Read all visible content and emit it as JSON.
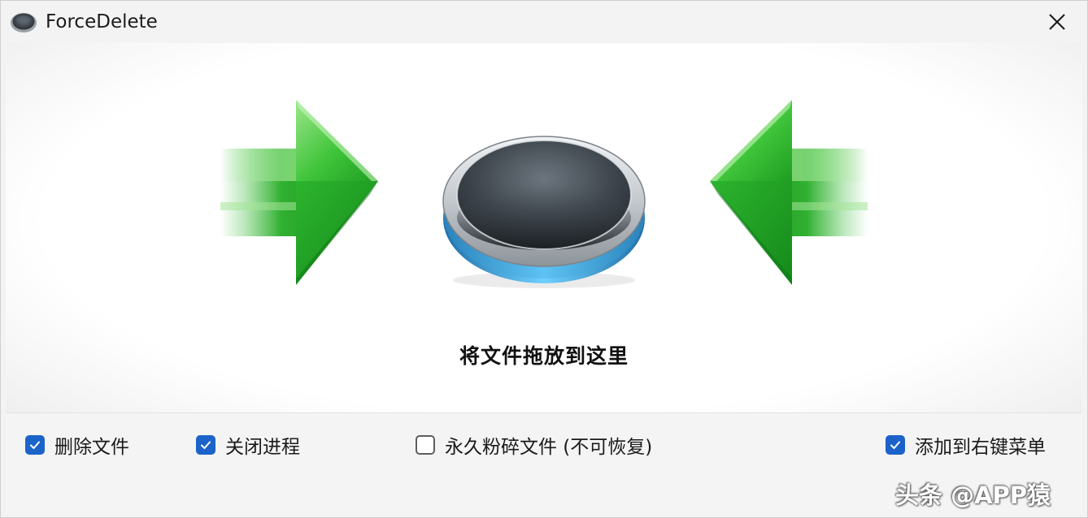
{
  "window": {
    "title": "ForceDelete",
    "icon": "hole-disc-icon",
    "close_icon": "close-icon"
  },
  "drop_zone": {
    "instruction": "将文件拖放到这里",
    "left_arrow_icon": "green-arrow-right-icon",
    "right_arrow_icon": "green-arrow-left-icon",
    "center_icon": "black-hole-icon"
  },
  "options": [
    {
      "label": "删除文件",
      "checked": true
    },
    {
      "label": "关闭进程",
      "checked": true
    },
    {
      "label": "永久粉碎文件 (不可恢复)",
      "checked": false
    },
    {
      "label": "添加到右键菜单",
      "checked": true
    }
  ],
  "watermark": "头条 @APP猿",
  "colors": {
    "checkbox_accent": "#1c63c9",
    "arrow_green": "#2fb52f",
    "hole_rim_blue": "#3fa9e0"
  }
}
